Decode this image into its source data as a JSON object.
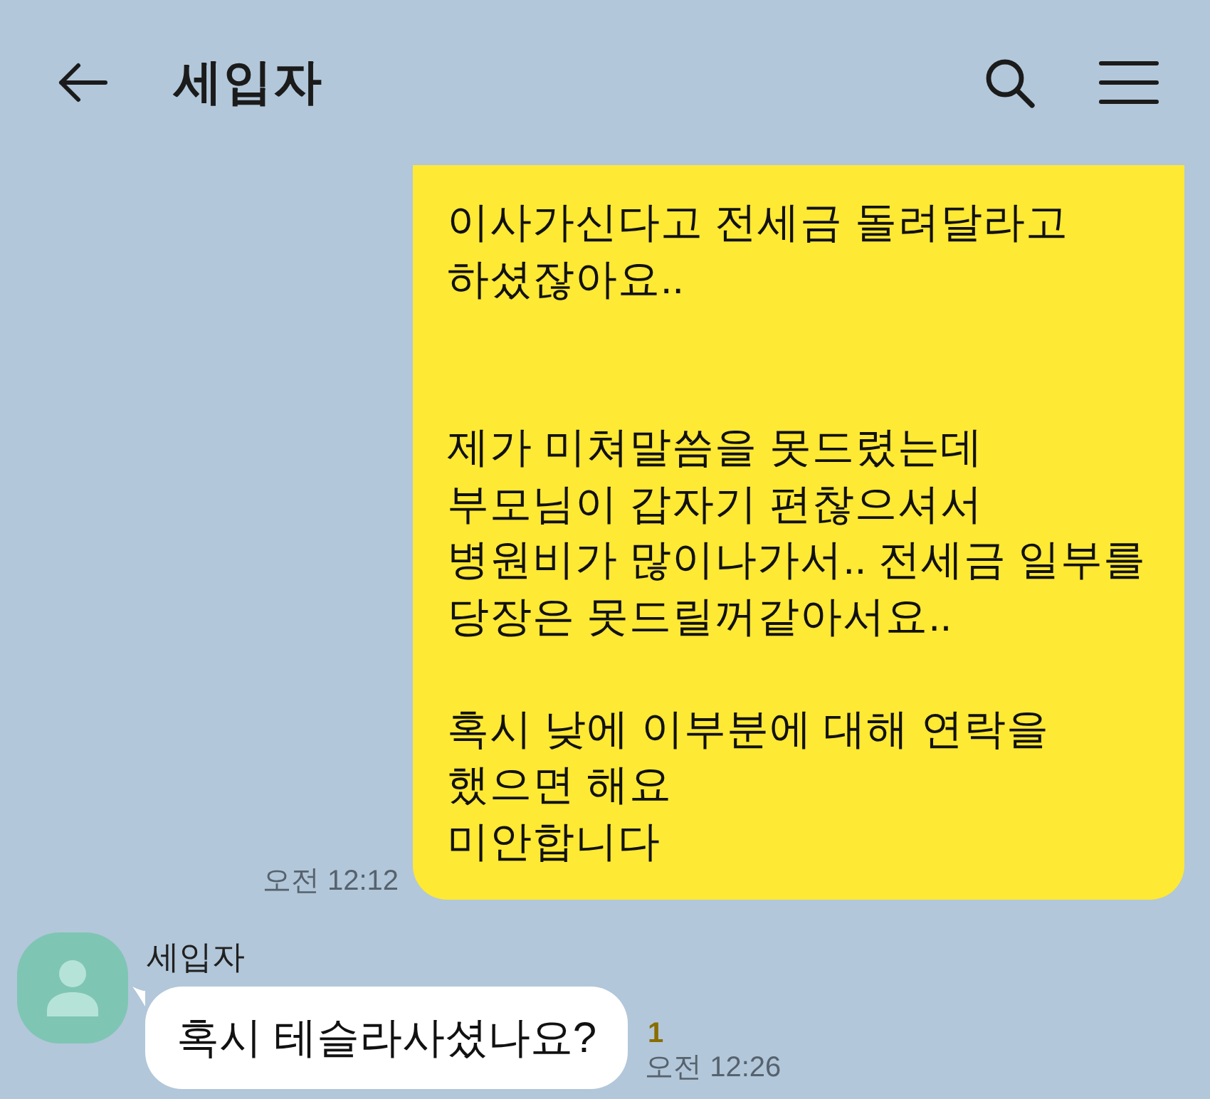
{
  "header": {
    "title": "세입자"
  },
  "messages": [
    {
      "kind": "outgoing",
      "text": "이사가신다고 전세금 돌려달라고\n하셨잖아요..\n\n\n제가 미쳐말씀을 못드렸는데\n부모님이 갑자기 편찮으셔서\n병원비가 많이나가서.. 전세금 일부를\n당장은 못드릴꺼같아서요..\n\n혹시 낮에 이부분에 대해 연락을\n했으면 해요\n미안합니다",
      "time": "오전 12:12"
    },
    {
      "kind": "incoming",
      "sender": "세입자",
      "text": "혹시 테슬라사셨나요?",
      "unread": "1",
      "time": "오전 12:26"
    }
  ]
}
